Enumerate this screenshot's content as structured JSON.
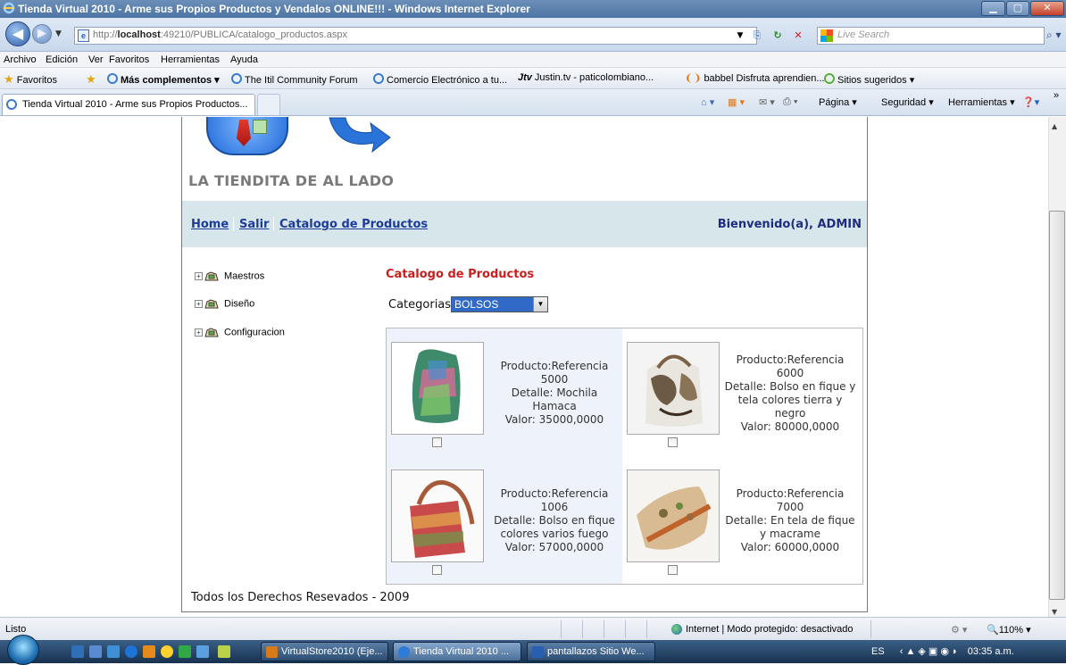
{
  "window": {
    "title": "Tienda Virtual 2010 - Arme sus Propios Productos y Vendalos ONLINE!!! - Windows Internet Explorer"
  },
  "address": {
    "url_prefix": "http://",
    "url_host": "localhost",
    "url_rest": ":49210/PUBLICA/catalogo_productos.aspx",
    "search_placeholder": "Live Search"
  },
  "menu": [
    "Archivo",
    "Edición",
    "Ver",
    "Favoritos",
    "Herramientas",
    "Ayuda"
  ],
  "favorites": {
    "label": "Favoritos",
    "items": [
      "Más complementos ▾",
      "The Itil Community Forum",
      "Comercio Electrónico a tu...",
      "Justin.tv - paticolombiano...",
      "babbel Disfruta aprendien...",
      "Sitios sugeridos ▾"
    ],
    "justin_badge": "Jtv"
  },
  "tab": {
    "label": "Tienda Virtual 2010 - Arme sus Propios Productos..."
  },
  "command_bar": {
    "pagina": "Página ▾",
    "seguridad": "Seguridad ▾",
    "herramientas": "Herramientas ▾",
    "chevron": "»"
  },
  "page": {
    "store_title": "LA TIENDITA DE AL LADO",
    "nav": {
      "home": "Home",
      "salir": "Salir",
      "catalogo": "Catalogo de Productos",
      "welcome": "Bienvenido(a), ADMIN"
    },
    "tree": [
      "Maestros",
      "Diseño",
      "Configuracion"
    ],
    "catalog_heading": "Catalogo de Productos",
    "categories_label": "Categorias:",
    "categories_selected": "BOLSOS",
    "products": [
      {
        "line1": "Producto:Referencia",
        "line2": "5000",
        "line3": "Detalle: Mochila",
        "line4": "Hamaca",
        "line5": "Valor: 35000,0000"
      },
      {
        "line1": "Producto:Referencia",
        "line2": "6000",
        "line3": "Detalle: Bolso en fique y",
        "line4": "tela colores tierra y",
        "line5": "negro",
        "line6": "Valor: 80000,0000"
      },
      {
        "line1": "Producto:Referencia",
        "line2": "1006",
        "line3": "Detalle: Bolso en fique",
        "line4": "colores varios fuego",
        "line5": "Valor: 57000,0000"
      },
      {
        "line1": "Producto:Referencia",
        "line2": "7000",
        "line3": "Detalle: En tela de fique",
        "line4": "y macrame",
        "line5": "Valor: 60000,0000"
      }
    ],
    "footer": "Todos los Derechos Resevados - 2009"
  },
  "status": {
    "left": "Listo",
    "zone": "Internet | Modo protegido: desactivado",
    "zoom": "110%"
  },
  "taskbar": {
    "buttons": [
      "VirtualStore2010 (Eje...",
      "Tienda Virtual 2010 ...",
      "pantallazos Sitio We..."
    ],
    "lang": "ES",
    "time": "03:35 a.m."
  },
  "colors": {
    "nav_band": "#d7e6ea",
    "link": "#1d3c9a",
    "heading_red": "#c8201f",
    "select_blue": "#3169c6"
  }
}
